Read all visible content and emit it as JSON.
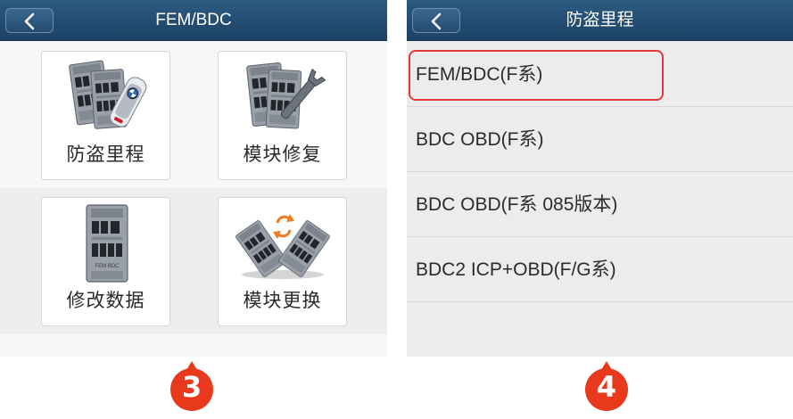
{
  "left_screen": {
    "title": "FEM/BDC",
    "tiles": [
      {
        "label": "防盗里程",
        "icon": "ecu-with-key-icon"
      },
      {
        "label": "模块修复",
        "icon": "ecu-with-wrench-icon"
      },
      {
        "label": "修改数据",
        "icon": "ecu-module-icon"
      },
      {
        "label": "模块更换",
        "icon": "ecu-swap-icon"
      }
    ],
    "module_print": "FEM BDC"
  },
  "right_screen": {
    "title": "防盗里程",
    "items": [
      {
        "label": "FEM/BDC(F系)",
        "highlighted": true
      },
      {
        "label": "BDC OBD(F系)",
        "highlighted": false
      },
      {
        "label": "BDC OBD(F系 085版本)",
        "highlighted": false
      },
      {
        "label": "BDC2 ICP+OBD(F/G系)",
        "highlighted": false
      }
    ]
  },
  "steps": [
    "3",
    "4"
  ],
  "colors": {
    "header": "#24496e",
    "highlight": "#e53838",
    "badge": "#e8391d",
    "swap_arrows": "#f07a1f"
  }
}
